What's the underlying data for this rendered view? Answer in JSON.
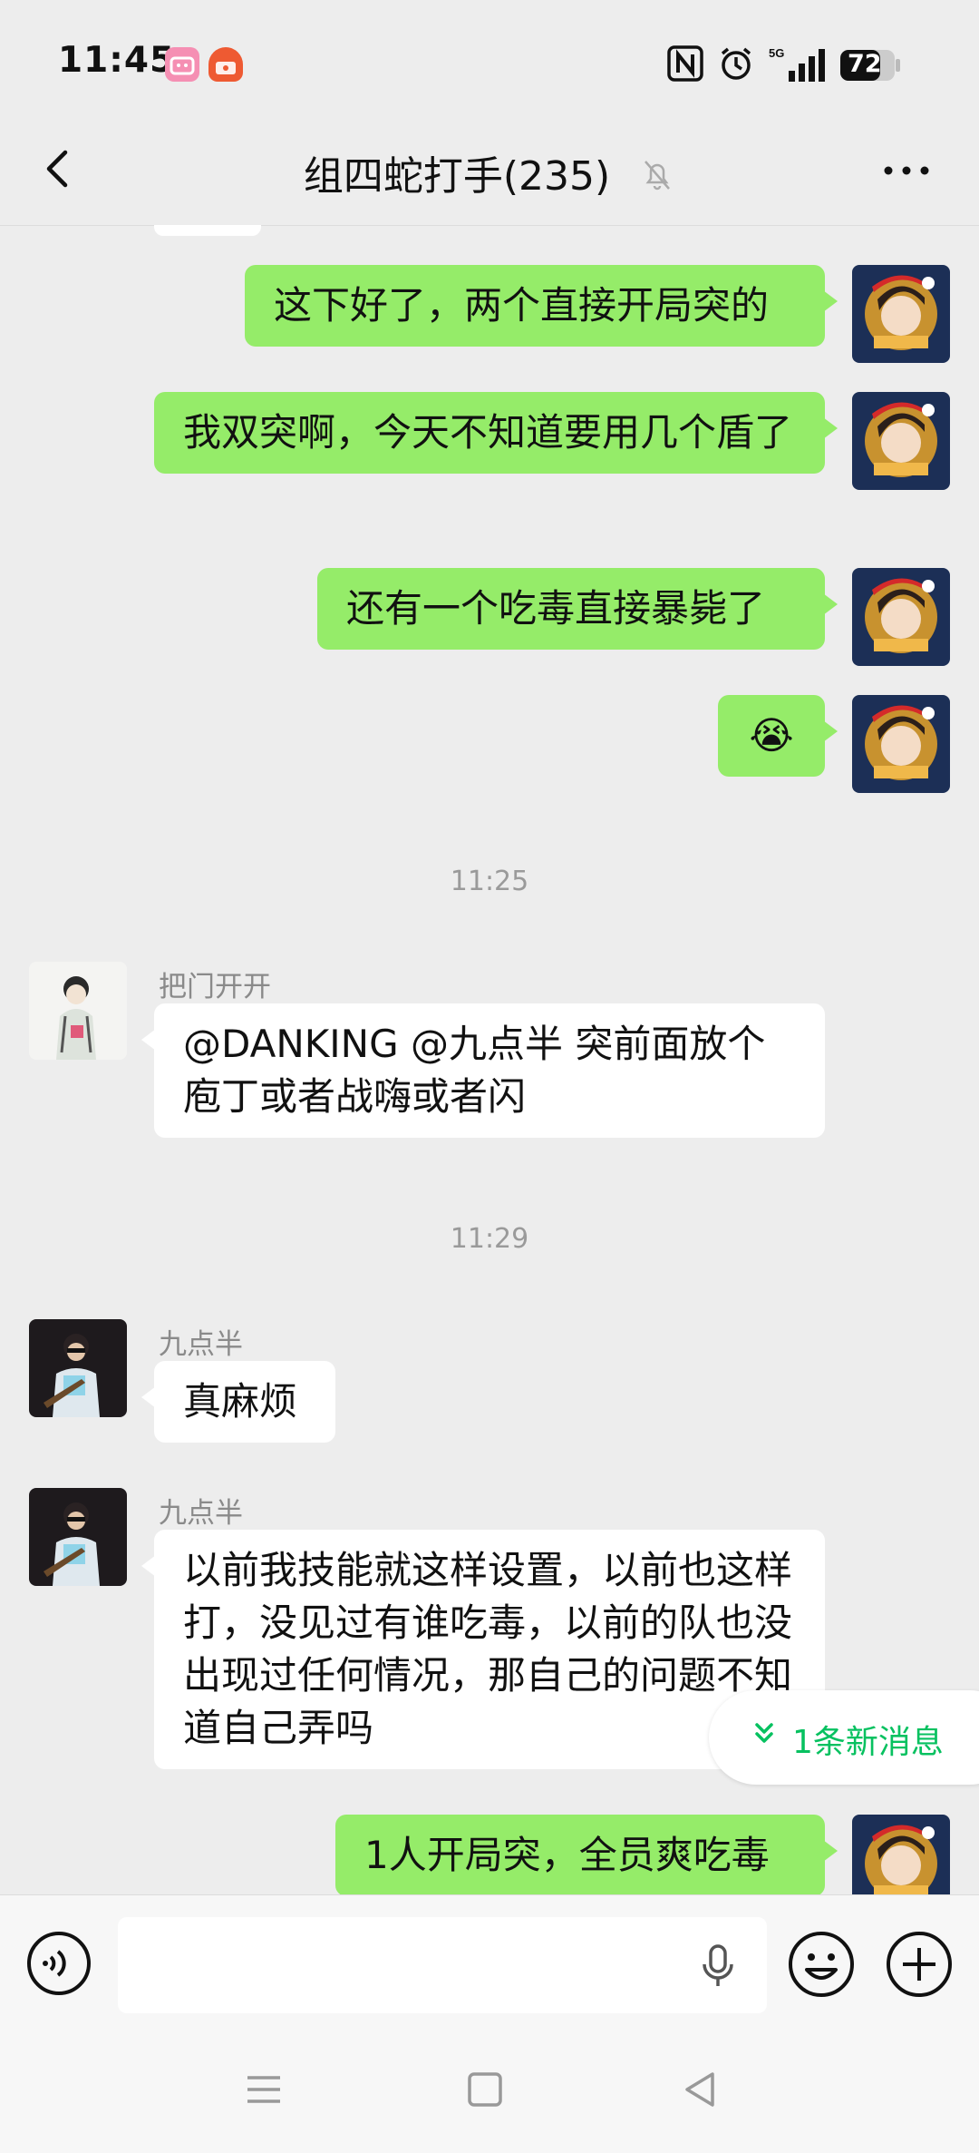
{
  "status_bar": {
    "time": "11:45",
    "battery": "72",
    "network": "5G"
  },
  "header": {
    "title": "组四蛇打手(235)"
  },
  "messages": [
    {
      "type": "me",
      "text": "这下好了，两个直接开局突的"
    },
    {
      "type": "me",
      "text": "我双突啊，今天不知道要用几个盾了"
    },
    {
      "type": "me",
      "text": "还有一个吃毒直接暴毙了"
    },
    {
      "type": "me",
      "text": "😭"
    },
    {
      "type": "time",
      "text": "11:25"
    },
    {
      "type": "other",
      "sender": "把门开开",
      "text": "@DANKING @九点半  突前面放个庖丁或者战嗨或者闪"
    },
    {
      "type": "time",
      "text": "11:29"
    },
    {
      "type": "other",
      "sender": "九点半",
      "text": "真麻烦"
    },
    {
      "type": "other",
      "sender": "九点半",
      "text": "以前我技能就这样设置，以前也这样打，没见过有谁吃毒，以前的队也没出现过任何情况，那自己的问题不知道自己弄吗"
    },
    {
      "type": "me",
      "text": "1人开局突，全员爽吃毒"
    }
  ],
  "new_messages": {
    "label": "1条新消息"
  },
  "input": {
    "placeholder": ""
  },
  "icons": {
    "back": "back-arrow-icon",
    "mute": "bell-off-icon",
    "more": "more-dots-icon",
    "voice": "voice-icon",
    "mic": "microphone-icon",
    "emoji": "emoji-icon",
    "plus": "plus-icon"
  },
  "colors": {
    "my_bubble": "#95ec69",
    "other_bubble": "#ffffff",
    "accent": "#07c160",
    "background": "#ededed"
  }
}
